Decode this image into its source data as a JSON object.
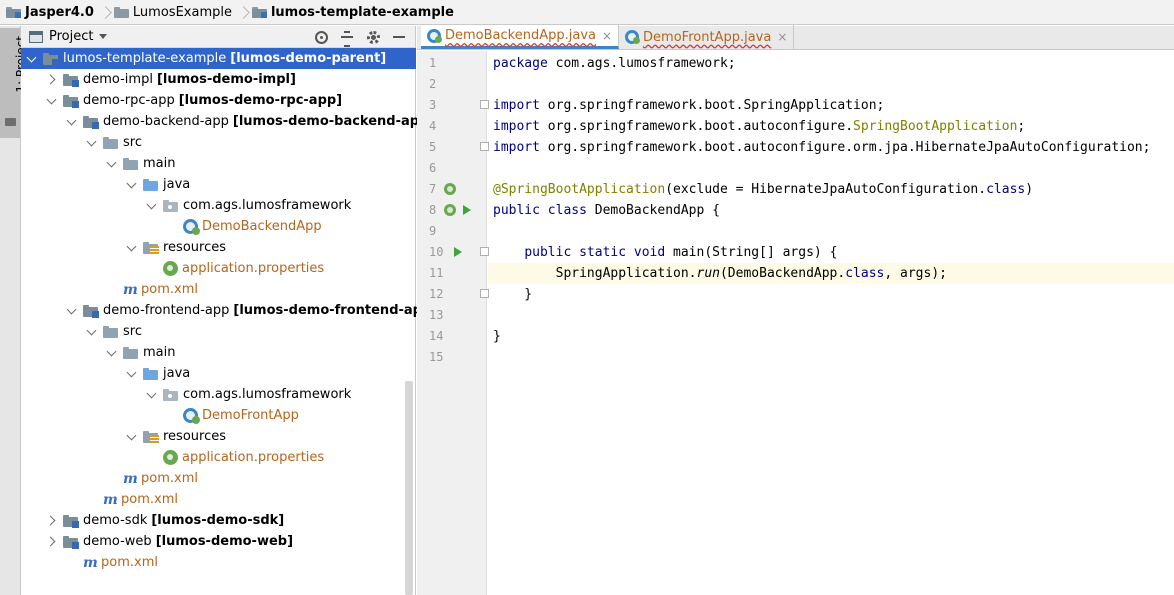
{
  "breadcrumb": [
    {
      "label": "Jasper4.0",
      "bold": true
    },
    {
      "label": "LumosExample",
      "bold": false
    },
    {
      "label": "lumos-template-example",
      "bold": true
    }
  ],
  "toolstrip": {
    "project_tab": "1: Project"
  },
  "project_panel": {
    "title": "Project",
    "tree": [
      {
        "label": "lumos-template-example",
        "module": "[lumos-demo-parent]",
        "icon": "module",
        "indent": 0,
        "arrow": "down",
        "selected": true
      },
      {
        "label": "demo-impl",
        "module": "[lumos-demo-impl]",
        "icon": "module",
        "indent": 1,
        "arrow": "right"
      },
      {
        "label": "demo-rpc-app",
        "module": "[lumos-demo-rpc-app]",
        "icon": "module",
        "indent": 1,
        "arrow": "down"
      },
      {
        "label": "demo-backend-app",
        "module": "[lumos-demo-backend-app]",
        "icon": "module",
        "indent": 2,
        "arrow": "down"
      },
      {
        "label": "src",
        "icon": "folder",
        "indent": 3,
        "arrow": "down"
      },
      {
        "label": "main",
        "icon": "folder",
        "indent": 4,
        "arrow": "down"
      },
      {
        "label": "java",
        "icon": "src",
        "indent": 5,
        "arrow": "down"
      },
      {
        "label": "com.ags.lumosframework",
        "icon": "pkg",
        "indent": 6,
        "arrow": "down"
      },
      {
        "label": "DemoBackendApp",
        "icon": "class",
        "indent": 7,
        "arrow": "none",
        "orange": true
      },
      {
        "label": "resources",
        "icon": "res",
        "indent": 5,
        "arrow": "down"
      },
      {
        "label": "application.properties",
        "icon": "spring",
        "indent": 6,
        "arrow": "none",
        "orange": true
      },
      {
        "label": "pom.xml",
        "icon": "maven",
        "indent": 4,
        "arrow": "none",
        "orange": true
      },
      {
        "label": "demo-frontend-app",
        "module": "[lumos-demo-frontend-app]",
        "icon": "module",
        "indent": 2,
        "arrow": "down"
      },
      {
        "label": "src",
        "icon": "folder",
        "indent": 3,
        "arrow": "down"
      },
      {
        "label": "main",
        "icon": "folder",
        "indent": 4,
        "arrow": "down"
      },
      {
        "label": "java",
        "icon": "src",
        "indent": 5,
        "arrow": "down"
      },
      {
        "label": "com.ags.lumosframework",
        "icon": "pkg",
        "indent": 6,
        "arrow": "down"
      },
      {
        "label": "DemoFrontApp",
        "icon": "class",
        "indent": 7,
        "arrow": "none",
        "orange": true
      },
      {
        "label": "resources",
        "icon": "res",
        "indent": 5,
        "arrow": "down"
      },
      {
        "label": "application.properties",
        "icon": "spring",
        "indent": 6,
        "arrow": "none",
        "orange": true
      },
      {
        "label": "pom.xml",
        "icon": "maven",
        "indent": 4,
        "arrow": "none",
        "orange": true
      },
      {
        "label": "pom.xml",
        "icon": "maven",
        "indent": 3,
        "arrow": "none",
        "orange": true
      },
      {
        "label": "demo-sdk",
        "module": "[lumos-demo-sdk]",
        "icon": "module",
        "indent": 1,
        "arrow": "right"
      },
      {
        "label": "demo-web",
        "module": "[lumos-demo-web]",
        "icon": "module",
        "indent": 1,
        "arrow": "right"
      },
      {
        "label": "pom.xml",
        "icon": "maven",
        "indent": 2,
        "arrow": "none",
        "orange": true
      }
    ]
  },
  "editor": {
    "tabs": [
      {
        "label": "DemoBackendApp.java",
        "active": true,
        "close": "×"
      },
      {
        "label": "DemoFrontApp.java",
        "active": false,
        "close": "×"
      }
    ],
    "current_line": 11,
    "lines": [
      {
        "n": "1",
        "tokens": [
          {
            "t": "package",
            "c": "kw"
          },
          {
            "t": " com.ags.lumosframework;"
          }
        ]
      },
      {
        "n": "2",
        "tokens": []
      },
      {
        "n": "3",
        "fold": true,
        "tokens": [
          {
            "t": "import",
            "c": "kw"
          },
          {
            "t": " org.springframework.boot.SpringApplication;"
          }
        ]
      },
      {
        "n": "4",
        "tokens": [
          {
            "t": "import",
            "c": "kw"
          },
          {
            "t": " org.springframework.boot.autoconfigure."
          },
          {
            "t": "SpringBootApplication",
            "c": "ann"
          },
          {
            "t": ";"
          }
        ]
      },
      {
        "n": "5",
        "fold": true,
        "tokens": [
          {
            "t": "import",
            "c": "kw"
          },
          {
            "t": " org.springframework.boot.autoconfigure.orm.jpa.HibernateJpaAutoConfiguration;"
          }
        ]
      },
      {
        "n": "6",
        "tokens": []
      },
      {
        "n": "7",
        "marker": "spring",
        "tokens": [
          {
            "t": "@SpringBootApplication",
            "c": "ann"
          },
          {
            "t": "(exclude = HibernateJpaAutoConfiguration."
          },
          {
            "t": "class",
            "c": "kw"
          },
          {
            "t": ")"
          }
        ]
      },
      {
        "n": "8",
        "marker": "spring-run",
        "tokens": [
          {
            "t": "public class",
            "c": "kw"
          },
          {
            "t": " DemoBackendApp {"
          }
        ]
      },
      {
        "n": "9",
        "tokens": []
      },
      {
        "n": "10",
        "marker": "run",
        "fold": true,
        "tokens": [
          {
            "t": "    "
          },
          {
            "t": "public static void",
            "c": "kw"
          },
          {
            "t": " main(String[] args) {"
          }
        ]
      },
      {
        "n": "11",
        "tokens": [
          {
            "t": "        SpringApplication."
          },
          {
            "t": "run",
            "c": "italic"
          },
          {
            "t": "(DemoBackendApp."
          },
          {
            "t": "class",
            "c": "kw"
          },
          {
            "t": ", args);"
          }
        ]
      },
      {
        "n": "12",
        "fold": true,
        "tokens": [
          {
            "t": "    }"
          }
        ]
      },
      {
        "n": "13",
        "tokens": []
      },
      {
        "n": "14",
        "tokens": [
          {
            "t": "}"
          }
        ]
      },
      {
        "n": "15",
        "tokens": []
      }
    ]
  }
}
